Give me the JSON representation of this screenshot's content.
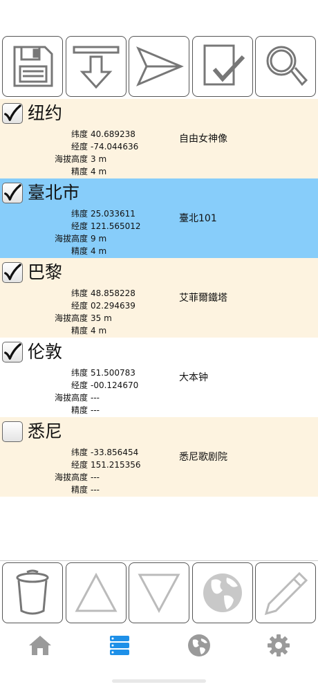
{
  "colors": {
    "row_default": "#fdf3e0",
    "row_white": "#ffffff",
    "row_selected": "#87cdfa",
    "tab_active": "#1e90e8",
    "tab_inactive": "#9a9a9a"
  },
  "labels": {
    "latitude": "纬度",
    "longitude": "经度",
    "altitude": "海拔高度",
    "accuracy": "精度"
  },
  "top_toolbar": [
    "save-icon",
    "download-icon",
    "send-icon",
    "checklist-icon",
    "search-icon"
  ],
  "bottom_toolbar": [
    "trash-icon",
    "arrow-up-icon",
    "arrow-down-icon",
    "globe-icon",
    "pencil-icon"
  ],
  "tabs": [
    {
      "icon": "home-icon",
      "active": false
    },
    {
      "icon": "list-icon",
      "active": true
    },
    {
      "icon": "globe-icon",
      "active": false
    },
    {
      "icon": "gear-icon",
      "active": false
    }
  ],
  "locations": [
    {
      "name": "纽约",
      "checked": true,
      "bg": "default",
      "latitude": "40.689238",
      "longitude": "-74.044636",
      "altitude": "3 m",
      "accuracy": "4 m",
      "landmark": "自由女神像"
    },
    {
      "name": "臺北市",
      "checked": true,
      "bg": "selected",
      "latitude": "25.033611",
      "longitude": "121.565012",
      "altitude": "9 m",
      "accuracy": "4 m",
      "landmark": "臺北101"
    },
    {
      "name": "巴黎",
      "checked": true,
      "bg": "default",
      "latitude": "48.858228",
      "longitude": "02.294639",
      "altitude": "35 m",
      "accuracy": "4 m",
      "landmark": "艾菲爾鐵塔"
    },
    {
      "name": "伦敦",
      "checked": true,
      "bg": "white",
      "latitude": "51.500783",
      "longitude": "-00.124670",
      "altitude": "---",
      "accuracy": "---",
      "landmark": "大本钟"
    },
    {
      "name": "悉尼",
      "checked": false,
      "bg": "default",
      "latitude": "-33.856454",
      "longitude": "151.215356",
      "altitude": "---",
      "accuracy": "---",
      "landmark": "悉尼歌剧院"
    }
  ]
}
